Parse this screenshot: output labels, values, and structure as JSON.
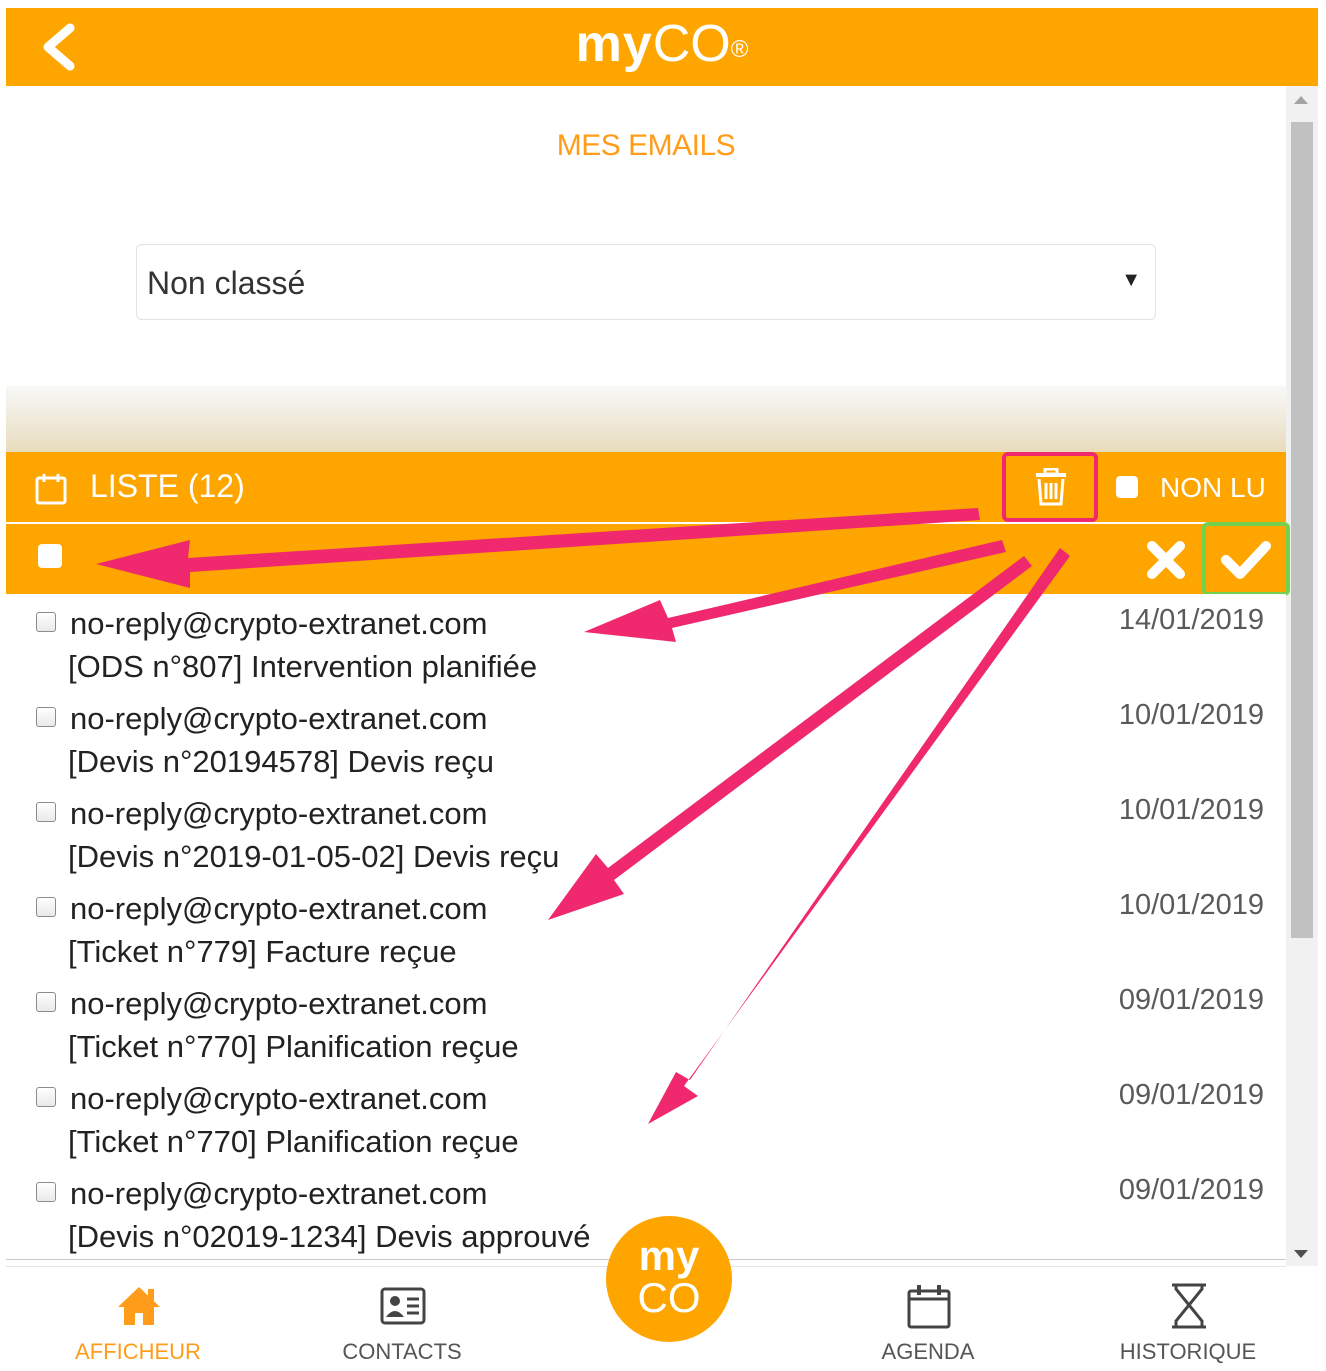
{
  "header": {
    "logo_my": "my",
    "logo_co": "CO",
    "logo_reg": "®"
  },
  "page": {
    "title": "MES EMAILS"
  },
  "filter": {
    "selected": "Non classé"
  },
  "list": {
    "title": "LISTE (12)",
    "unread_label": "NON LU"
  },
  "emails": [
    {
      "sender": "no-reply@crypto-extranet.com",
      "subject": "[ODS n°807] Intervention planifiée",
      "date": "14/01/2019"
    },
    {
      "sender": "no-reply@crypto-extranet.com",
      "subject": "[Devis n°20194578] Devis reçu",
      "date": "10/01/2019"
    },
    {
      "sender": "no-reply@crypto-extranet.com",
      "subject": "[Devis n°2019-01-05-02] Devis reçu",
      "date": "10/01/2019"
    },
    {
      "sender": "no-reply@crypto-extranet.com",
      "subject": "[Ticket n°779] Facture reçue",
      "date": "10/01/2019"
    },
    {
      "sender": "no-reply@crypto-extranet.com",
      "subject": "[Ticket n°770] Planification reçue",
      "date": "09/01/2019"
    },
    {
      "sender": "no-reply@crypto-extranet.com",
      "subject": "[Ticket n°770] Planification reçue",
      "date": "09/01/2019"
    },
    {
      "sender": "no-reply@crypto-extranet.com",
      "subject": "[Devis n°02019-1234] Devis approuvé",
      "date": "09/01/2019"
    }
  ],
  "nav": {
    "afficheur": "AFFICHEUR",
    "contacts": "CONTACTS",
    "center_my": "my",
    "center_co": "CO",
    "agenda": "AGENDA",
    "historique": "HISTORIQUE"
  },
  "colors": {
    "brand_orange": "#ffa500",
    "title_orange": "#ff9d1a",
    "annotation_pink": "#f0286e",
    "annotation_green": "#74d14f"
  },
  "icons": {
    "back": "chevron-left-icon",
    "calendar": "calendar-icon",
    "trash": "trash-icon",
    "close": "close-icon",
    "check": "check-icon",
    "home": "home-icon",
    "contacts": "contact-card-icon",
    "agenda": "calendar-icon",
    "history": "hourglass-icon"
  }
}
